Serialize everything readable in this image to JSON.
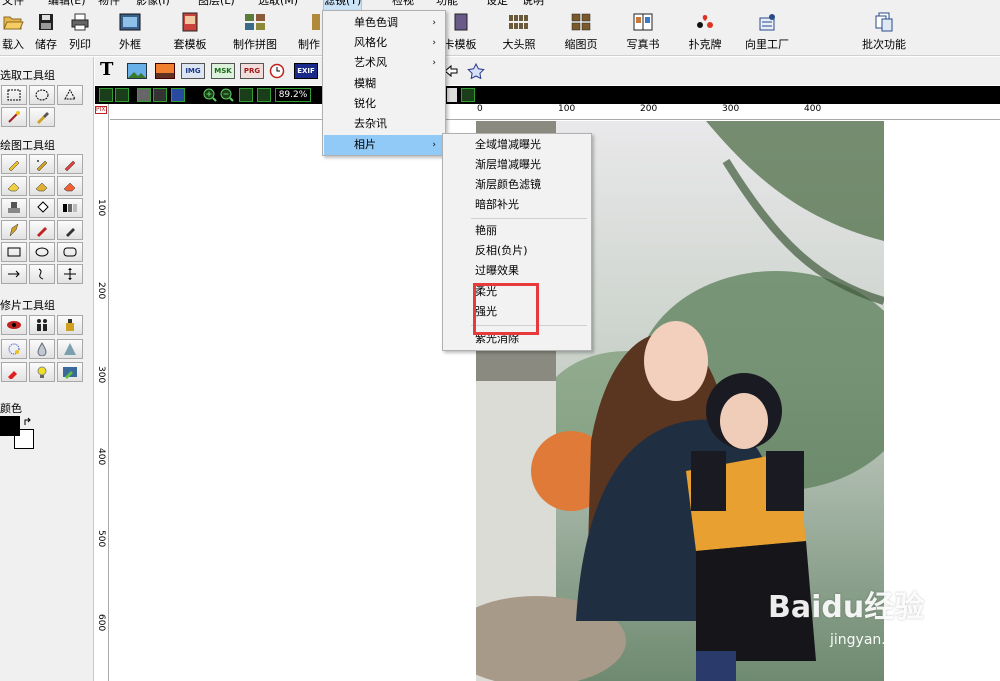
{
  "menubar": {
    "items": [
      {
        "label": "文件"
      },
      {
        "label": "编辑(E)"
      },
      {
        "label": "物件"
      },
      {
        "label": "影像(I)"
      },
      {
        "label": "图层(L)"
      },
      {
        "label": "选取(M)"
      },
      {
        "label": "滤镜(T)"
      },
      {
        "label": "检视"
      },
      {
        "label": "功能"
      },
      {
        "label": "设定"
      },
      {
        "label": "说明"
      }
    ]
  },
  "toolbar": {
    "load": "载入",
    "save": "储存",
    "print": "列印",
    "outer_frame": "外框",
    "template": "套模板",
    "make_collage": "制作拼图",
    "make_partial": "制作",
    "card_template": "卡模板",
    "big_head": "大头照",
    "thumbnail": "缩图页",
    "photo_book": "写真书",
    "poker": "扑克牌",
    "factory": "向里工厂",
    "batch": "批次功能"
  },
  "leftpanel": {
    "select_group": "选取工具组",
    "draw_group": "绘图工具组",
    "retouch_group": "修片工具组",
    "color": "颜色"
  },
  "toolbar2": {
    "text_tool": "T",
    "img": "IMG",
    "msk": "MSK",
    "prg": "PRG",
    "exif": "EXIF"
  },
  "toolbar3": {
    "zoom": "89.2%"
  },
  "ruler": {
    "h": [
      "0",
      "100",
      "200",
      "300",
      "400"
    ],
    "v": [
      "100",
      "200",
      "300",
      "400",
      "500",
      "600"
    ],
    "corner": "PIX"
  },
  "filter_menu": {
    "items": [
      {
        "label": "单色色调",
        "arrow": "›"
      },
      {
        "label": "风格化",
        "arrow": "›"
      },
      {
        "label": "艺术风",
        "arrow": "›"
      },
      {
        "label": "模糊",
        "arrow": ""
      },
      {
        "label": "锐化",
        "arrow": ""
      },
      {
        "label": "去杂讯",
        "arrow": ""
      },
      {
        "label": "相片",
        "arrow": "›"
      }
    ]
  },
  "photo_menu": {
    "items": [
      {
        "label": "全域增减曝光"
      },
      {
        "label": "渐层增减曝光"
      },
      {
        "label": "渐层颜色滤镜"
      },
      {
        "label": "暗部补光"
      },
      {
        "label": "艳丽"
      },
      {
        "label": "反相(负片)"
      },
      {
        "label": "过曝效果"
      },
      {
        "label": "柔光"
      },
      {
        "label": "强光"
      },
      {
        "label": "紫光消除"
      }
    ]
  },
  "watermark": {
    "logo": "Baidu经验",
    "url": "jingyan.baidu.com"
  },
  "colors": {
    "menu_highlight": "#91c9f7",
    "annotation_red": "#e8393b",
    "foreground": "#000000",
    "background": "#ffffff"
  }
}
